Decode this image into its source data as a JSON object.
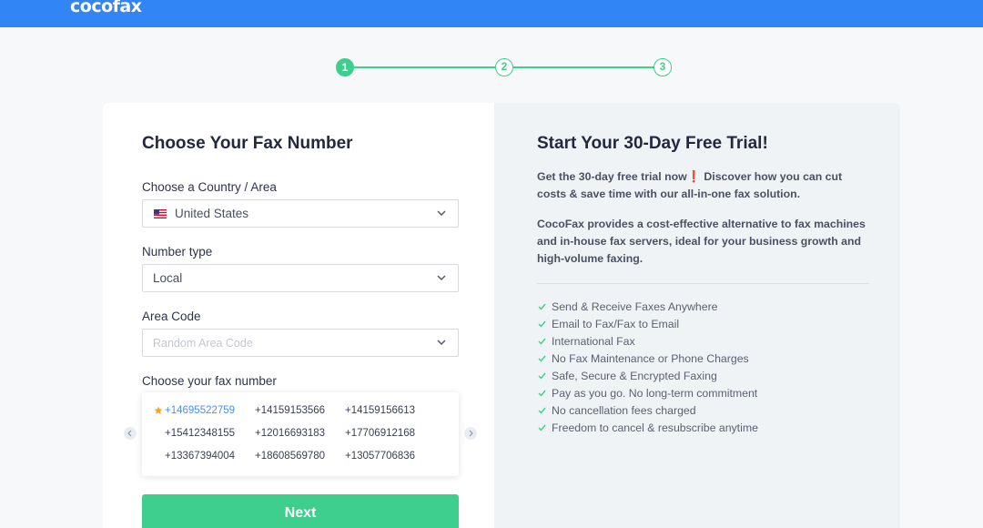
{
  "brand": {
    "logo": "cocofax",
    "bar_color": "#3285f4",
    "accent": "#3ecf8e"
  },
  "stepper": {
    "current": 1,
    "steps": [
      "1",
      "2",
      "3"
    ]
  },
  "form": {
    "title": "Choose Your Fax Number",
    "country_label": "Choose a Country / Area",
    "country_value": "United States",
    "country_icon": "us-flag-icon",
    "number_type_label": "Number type",
    "number_type_value": "Local",
    "area_code_label": "Area Code",
    "area_code_placeholder": "Random Area Code",
    "fax_number_label": "Choose your fax number",
    "numbers": [
      [
        "+14695522759",
        "+14159153566",
        "+14159156613"
      ],
      [
        "+15412348155",
        "+12016693183",
        "+17706912168"
      ],
      [
        "+13367394004",
        "+18608569780",
        "+13057706836"
      ]
    ],
    "selected_number": "+14695522759",
    "prev_icon": "chevron-left-icon",
    "next_icon": "chevron-right-icon",
    "next_label": "Next"
  },
  "promo": {
    "title": "Start Your 30-Day Free Trial!",
    "para1": "Get the 30-day free trial now❗ Discover how you can cut costs & save time with our all-in-one fax solution.",
    "para2": "CocoFax provides a cost-effective alternative to fax machines and in-house fax servers, ideal for your business growth and high-volume faxing.",
    "features": [
      "Send & Receive Faxes Anywhere",
      "Email to Fax/Fax to Email",
      "International Fax",
      "No Fax Maintenance or Phone Charges",
      "Safe, Secure & Encrypted Faxing",
      "Pay as you go. No long-term commitment",
      "No cancellation fees charged",
      "Freedom to cancel & resubscribe anytime"
    ]
  }
}
